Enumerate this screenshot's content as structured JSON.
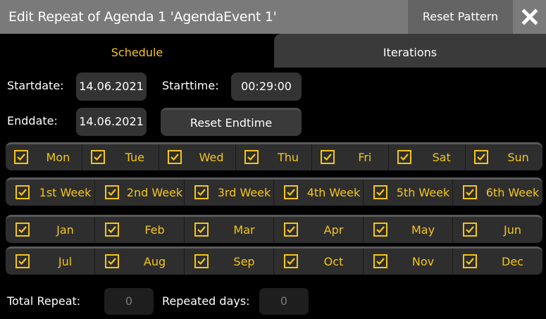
{
  "window": {
    "title": "Edit Repeat of Agenda 1 'AgendaEvent 1'",
    "reset_pattern_label": "Reset Pattern",
    "close_icon": "close-icon"
  },
  "tabs": [
    {
      "label": "Schedule",
      "active": true
    },
    {
      "label": "Iterations",
      "active": false
    }
  ],
  "schedule": {
    "startdate_label": "Startdate:",
    "startdate_value": "14.06.2021",
    "starttime_label": "Starttime:",
    "starttime_value": "00:29:00",
    "enddate_label": "Enddate:",
    "enddate_value": "14.06.2021",
    "reset_endtime_label": "Reset Endtime"
  },
  "weekdays": [
    {
      "label": "Mon",
      "checked": true
    },
    {
      "label": "Tue",
      "checked": true
    },
    {
      "label": "Wed",
      "checked": true
    },
    {
      "label": "Thu",
      "checked": true
    },
    {
      "label": "Fri",
      "checked": true
    },
    {
      "label": "Sat",
      "checked": true
    },
    {
      "label": "Sun",
      "checked": true
    }
  ],
  "weeks": [
    {
      "label": "1st Week",
      "checked": true
    },
    {
      "label": "2nd Week",
      "checked": true
    },
    {
      "label": "3rd Week",
      "checked": true
    },
    {
      "label": "4th Week",
      "checked": true
    },
    {
      "label": "5th Week",
      "checked": true
    },
    {
      "label": "6th Week",
      "checked": true
    }
  ],
  "months_row1": [
    {
      "label": "Jan",
      "checked": true
    },
    {
      "label": "Feb",
      "checked": true
    },
    {
      "label": "Mar",
      "checked": true
    },
    {
      "label": "Apr",
      "checked": true
    },
    {
      "label": "May",
      "checked": true
    },
    {
      "label": "Jun",
      "checked": true
    }
  ],
  "months_row2": [
    {
      "label": "Jul",
      "checked": true
    },
    {
      "label": "Aug",
      "checked": true
    },
    {
      "label": "Sep",
      "checked": true
    },
    {
      "label": "Oct",
      "checked": true
    },
    {
      "label": "Nov",
      "checked": true
    },
    {
      "label": "Dec",
      "checked": true
    }
  ],
  "footer": {
    "total_repeat_label": "Total Repeat:",
    "total_repeat_value": "0",
    "repeated_days_label": "Repeated days:",
    "repeated_days_value": "0"
  },
  "colors": {
    "accent": "#f5c518",
    "titlebar": "#7a7a7a",
    "background": "#000000",
    "button": "#3a3a3a"
  }
}
